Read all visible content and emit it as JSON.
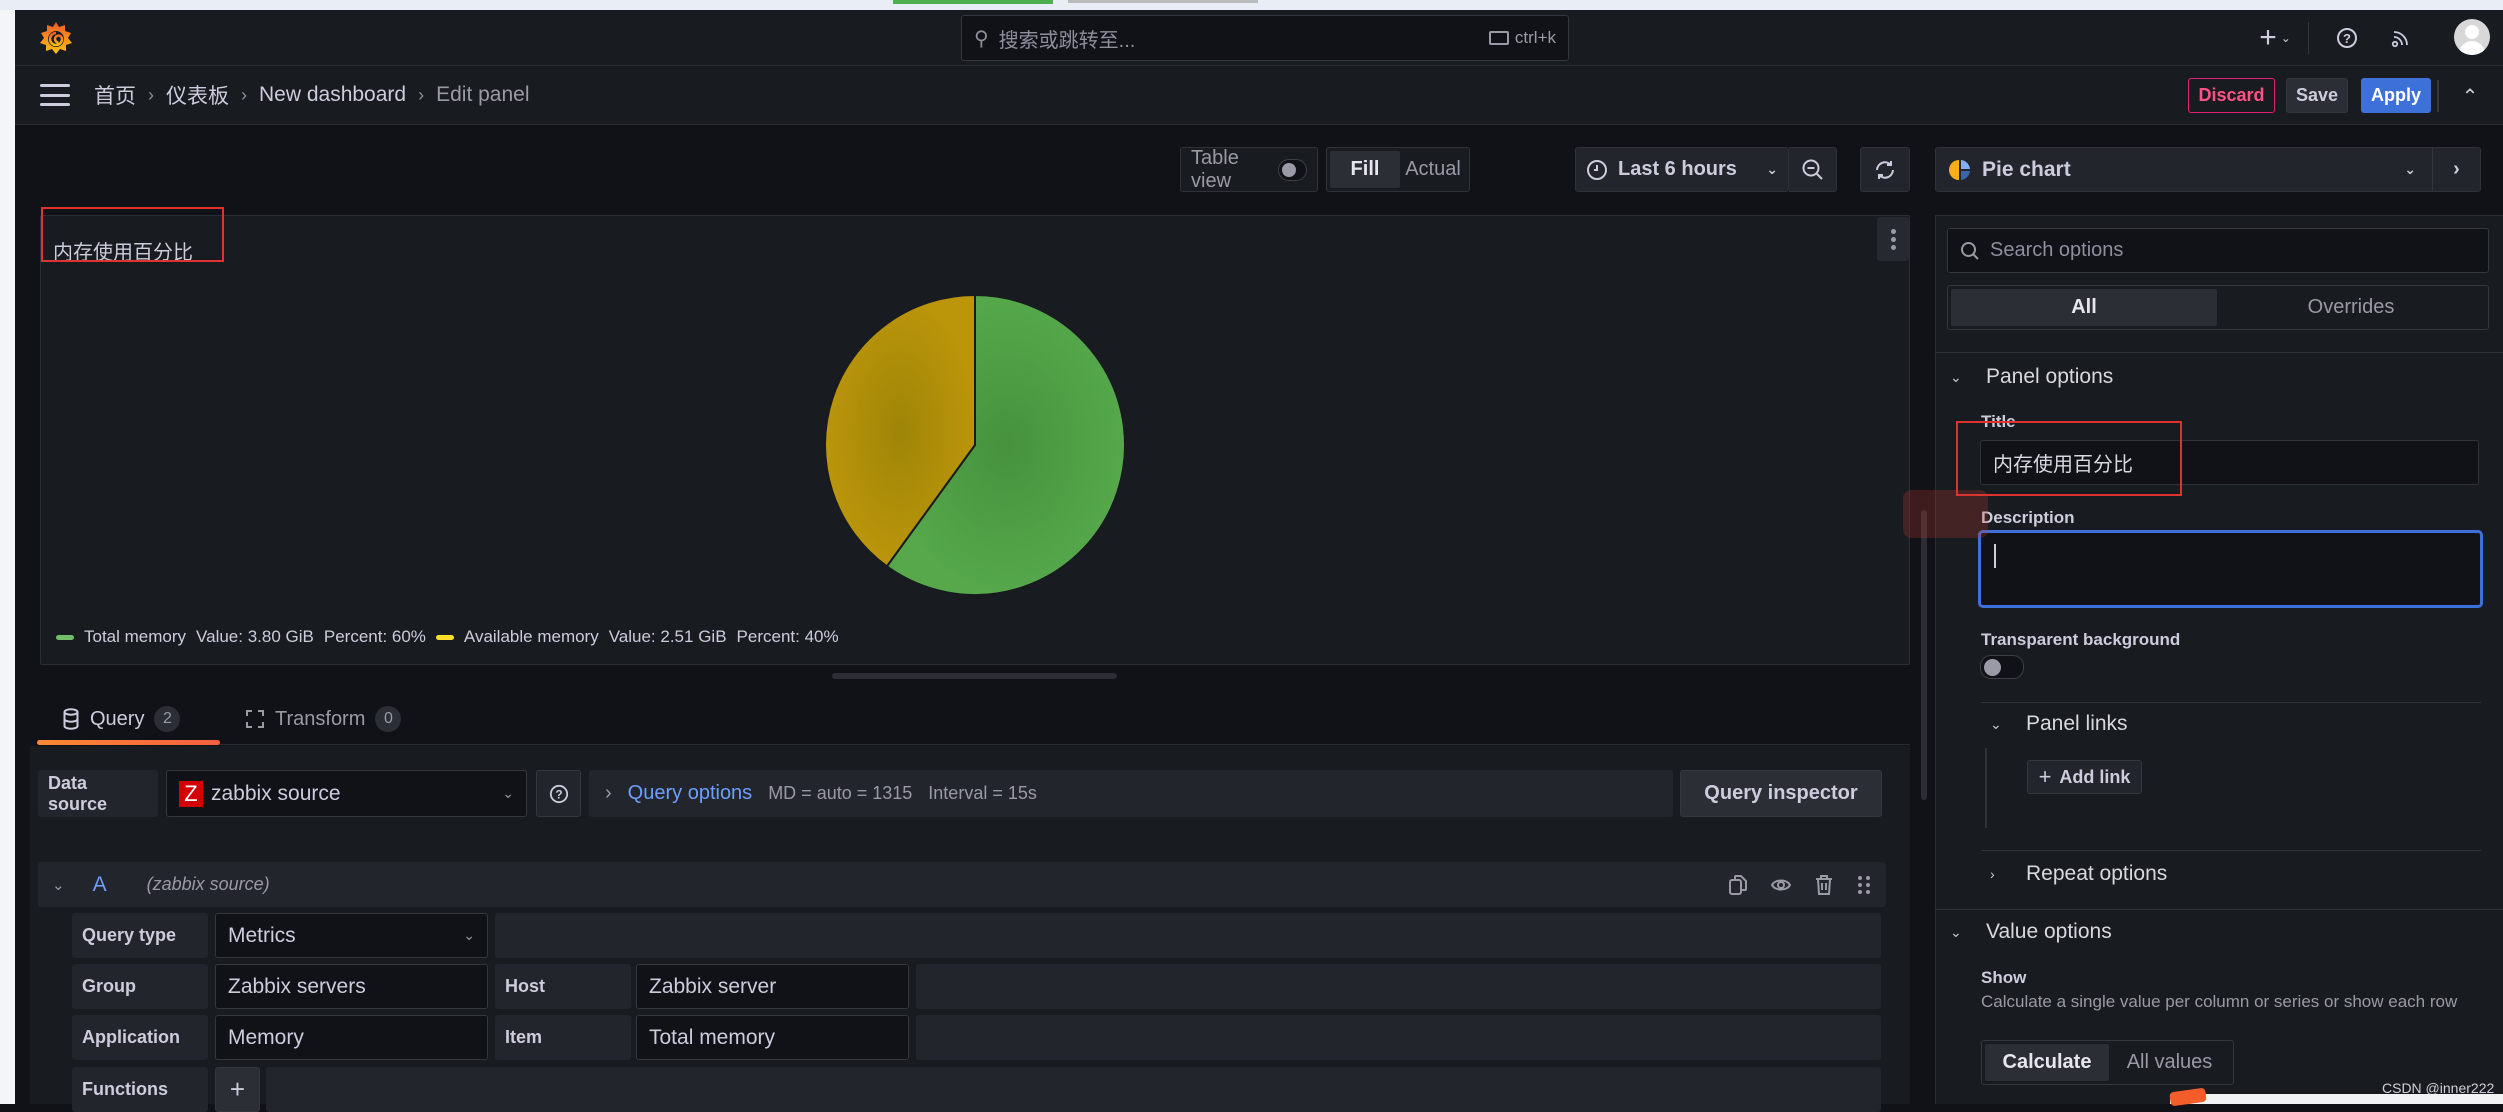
{
  "topnav": {
    "search_placeholder": "搜索或跳转至...",
    "search_shortcut": "ctrl+k",
    "add_label": "+",
    "icons": [
      "grafana-logo-icon",
      "search-icon",
      "keyboard-icon",
      "plus-icon",
      "chevron-down-icon",
      "help-icon",
      "news-rss-icon",
      "user-avatar-icon"
    ]
  },
  "breadcrumb": {
    "items": [
      "首页",
      "仪表板",
      "New dashboard",
      "Edit panel"
    ],
    "separator": "›"
  },
  "actions": {
    "discard": "Discard",
    "save": "Save",
    "apply": "Apply"
  },
  "toolbar": {
    "table_view_label": "Table view",
    "table_view_on": false,
    "fill_label": "Fill",
    "actual_label": "Actual",
    "fill_selected": "Fill",
    "time_range": "Last 6 hours"
  },
  "panel": {
    "title": "内存使用百分比",
    "legend": [
      {
        "name": "Total memory",
        "value_text": "Value: 3.80 GiB",
        "percent_text": "Percent: 60%",
        "color": "#73bf69"
      },
      {
        "name": "Available memory",
        "value_text": "Value: 2.51 GiB",
        "percent_text": "Percent: 40%",
        "color": "#fade2a"
      }
    ]
  },
  "chart_data": {
    "type": "pie",
    "title": "内存使用百分比",
    "series": [
      {
        "name": "Total memory",
        "value": 3.8,
        "unit": "GiB",
        "percent": 60,
        "color": "#56a64b"
      },
      {
        "name": "Available memory",
        "value": 2.51,
        "unit": "GiB",
        "percent": 40,
        "color": "#b8930a"
      }
    ],
    "legend_position": "bottom"
  },
  "query_tabs": [
    {
      "label": "Query",
      "count": "2",
      "active": true
    },
    {
      "label": "Transform",
      "count": "0",
      "active": false
    }
  ],
  "query": {
    "data_source_label": "Data source",
    "data_source_value": "zabbix source",
    "data_source_logo": "Z",
    "query_options_label": "Query options",
    "md_text": "MD = auto = 1315",
    "interval_text": "Interval = 15s",
    "inspector_label": "Query inspector",
    "row": {
      "letter": "A",
      "source": "(zabbix source)",
      "fields": {
        "query_type_label": "Query type",
        "query_type_value": "Metrics",
        "group_label": "Group",
        "group_value": "Zabbix servers",
        "host_label": "Host",
        "host_value": "Zabbix server",
        "application_label": "Application",
        "application_value": "Memory",
        "item_label": "Item",
        "item_value": "Total memory",
        "functions_label": "Functions",
        "functions_add": "+"
      }
    }
  },
  "options_pane": {
    "visualization": "Pie chart",
    "search_placeholder": "Search options",
    "tabs": [
      "All",
      "Overrides"
    ],
    "active_tab": "All",
    "panel_options": {
      "header": "Panel options",
      "title_label": "Title",
      "title_value": "内存使用百分比",
      "description_label": "Description",
      "description_value": "",
      "transparent_label": "Transparent background",
      "transparent_on": false,
      "panel_links_header": "Panel links",
      "add_link": "Add link",
      "repeat_options_header": "Repeat options"
    },
    "value_options": {
      "header": "Value options",
      "show_label": "Show",
      "show_description": "Calculate a single value per column or series or show each row",
      "choices": [
        "Calculate",
        "All values"
      ],
      "selected": "Calculate"
    }
  },
  "watermark": "CSDN @inner222"
}
